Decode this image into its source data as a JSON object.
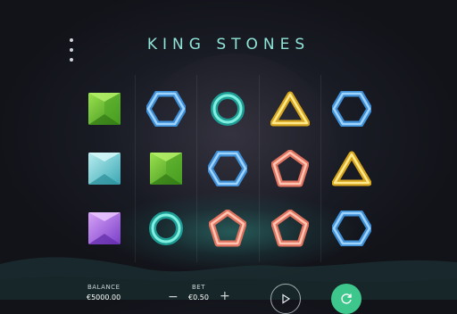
{
  "game": {
    "title": "KING STONES"
  },
  "reels": [
    [
      "green-square",
      "teal-square",
      "purple-square"
    ],
    [
      "blue-hexagon",
      "green-square",
      "teal-ring"
    ],
    [
      "teal-ring",
      "blue-hexagon",
      "coral-pentagon"
    ],
    [
      "yellow-triangle",
      "coral-pentagon",
      "coral-pentagon"
    ],
    [
      "blue-hexagon",
      "yellow-triangle",
      "blue-hexagon"
    ]
  ],
  "hud": {
    "balance_label": "BALANCE",
    "balance_value": "€5000.00",
    "bet_label": "BET",
    "bet_value": "€0.50",
    "bet_decrease": "−",
    "bet_increase": "+"
  },
  "colors": {
    "title": "#8fe3d6",
    "auto_button": "#3ec78c"
  }
}
